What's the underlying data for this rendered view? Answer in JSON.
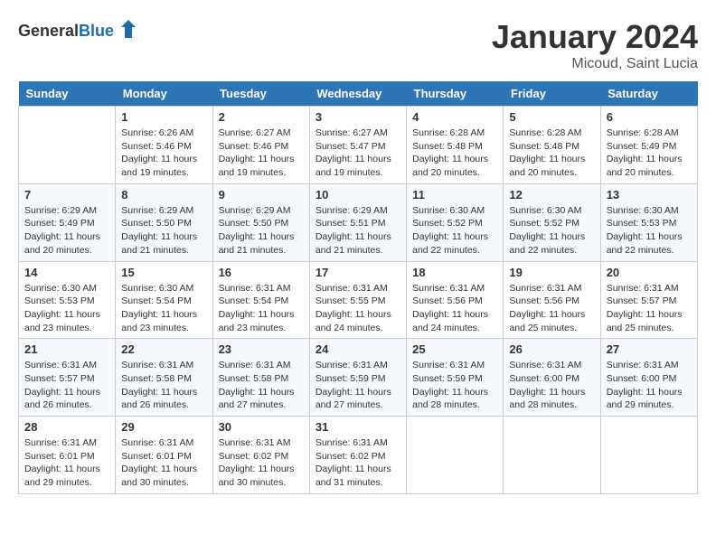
{
  "header": {
    "logo_general": "General",
    "logo_blue": "Blue",
    "month_title": "January 2024",
    "location": "Micoud, Saint Lucia"
  },
  "days_of_week": [
    "Sunday",
    "Monday",
    "Tuesday",
    "Wednesday",
    "Thursday",
    "Friday",
    "Saturday"
  ],
  "weeks": [
    [
      {
        "day": "",
        "info": ""
      },
      {
        "day": "1",
        "info": "Sunrise: 6:26 AM\nSunset: 5:46 PM\nDaylight: 11 hours\nand 19 minutes."
      },
      {
        "day": "2",
        "info": "Sunrise: 6:27 AM\nSunset: 5:46 PM\nDaylight: 11 hours\nand 19 minutes."
      },
      {
        "day": "3",
        "info": "Sunrise: 6:27 AM\nSunset: 5:47 PM\nDaylight: 11 hours\nand 19 minutes."
      },
      {
        "day": "4",
        "info": "Sunrise: 6:28 AM\nSunset: 5:48 PM\nDaylight: 11 hours\nand 20 minutes."
      },
      {
        "day": "5",
        "info": "Sunrise: 6:28 AM\nSunset: 5:48 PM\nDaylight: 11 hours\nand 20 minutes."
      },
      {
        "day": "6",
        "info": "Sunrise: 6:28 AM\nSunset: 5:49 PM\nDaylight: 11 hours\nand 20 minutes."
      }
    ],
    [
      {
        "day": "7",
        "info": "Sunrise: 6:29 AM\nSunset: 5:49 PM\nDaylight: 11 hours\nand 20 minutes."
      },
      {
        "day": "8",
        "info": "Sunrise: 6:29 AM\nSunset: 5:50 PM\nDaylight: 11 hours\nand 21 minutes."
      },
      {
        "day": "9",
        "info": "Sunrise: 6:29 AM\nSunset: 5:50 PM\nDaylight: 11 hours\nand 21 minutes."
      },
      {
        "day": "10",
        "info": "Sunrise: 6:29 AM\nSunset: 5:51 PM\nDaylight: 11 hours\nand 21 minutes."
      },
      {
        "day": "11",
        "info": "Sunrise: 6:30 AM\nSunset: 5:52 PM\nDaylight: 11 hours\nand 22 minutes."
      },
      {
        "day": "12",
        "info": "Sunrise: 6:30 AM\nSunset: 5:52 PM\nDaylight: 11 hours\nand 22 minutes."
      },
      {
        "day": "13",
        "info": "Sunrise: 6:30 AM\nSunset: 5:53 PM\nDaylight: 11 hours\nand 22 minutes."
      }
    ],
    [
      {
        "day": "14",
        "info": "Sunrise: 6:30 AM\nSunset: 5:53 PM\nDaylight: 11 hours\nand 23 minutes."
      },
      {
        "day": "15",
        "info": "Sunrise: 6:30 AM\nSunset: 5:54 PM\nDaylight: 11 hours\nand 23 minutes."
      },
      {
        "day": "16",
        "info": "Sunrise: 6:31 AM\nSunset: 5:54 PM\nDaylight: 11 hours\nand 23 minutes."
      },
      {
        "day": "17",
        "info": "Sunrise: 6:31 AM\nSunset: 5:55 PM\nDaylight: 11 hours\nand 24 minutes."
      },
      {
        "day": "18",
        "info": "Sunrise: 6:31 AM\nSunset: 5:56 PM\nDaylight: 11 hours\nand 24 minutes."
      },
      {
        "day": "19",
        "info": "Sunrise: 6:31 AM\nSunset: 5:56 PM\nDaylight: 11 hours\nand 25 minutes."
      },
      {
        "day": "20",
        "info": "Sunrise: 6:31 AM\nSunset: 5:57 PM\nDaylight: 11 hours\nand 25 minutes."
      }
    ],
    [
      {
        "day": "21",
        "info": "Sunrise: 6:31 AM\nSunset: 5:57 PM\nDaylight: 11 hours\nand 26 minutes."
      },
      {
        "day": "22",
        "info": "Sunrise: 6:31 AM\nSunset: 5:58 PM\nDaylight: 11 hours\nand 26 minutes."
      },
      {
        "day": "23",
        "info": "Sunrise: 6:31 AM\nSunset: 5:58 PM\nDaylight: 11 hours\nand 27 minutes."
      },
      {
        "day": "24",
        "info": "Sunrise: 6:31 AM\nSunset: 5:59 PM\nDaylight: 11 hours\nand 27 minutes."
      },
      {
        "day": "25",
        "info": "Sunrise: 6:31 AM\nSunset: 5:59 PM\nDaylight: 11 hours\nand 28 minutes."
      },
      {
        "day": "26",
        "info": "Sunrise: 6:31 AM\nSunset: 6:00 PM\nDaylight: 11 hours\nand 28 minutes."
      },
      {
        "day": "27",
        "info": "Sunrise: 6:31 AM\nSunset: 6:00 PM\nDaylight: 11 hours\nand 29 minutes."
      }
    ],
    [
      {
        "day": "28",
        "info": "Sunrise: 6:31 AM\nSunset: 6:01 PM\nDaylight: 11 hours\nand 29 minutes."
      },
      {
        "day": "29",
        "info": "Sunrise: 6:31 AM\nSunset: 6:01 PM\nDaylight: 11 hours\nand 30 minutes."
      },
      {
        "day": "30",
        "info": "Sunrise: 6:31 AM\nSunset: 6:02 PM\nDaylight: 11 hours\nand 30 minutes."
      },
      {
        "day": "31",
        "info": "Sunrise: 6:31 AM\nSunset: 6:02 PM\nDaylight: 11 hours\nand 31 minutes."
      },
      {
        "day": "",
        "info": ""
      },
      {
        "day": "",
        "info": ""
      },
      {
        "day": "",
        "info": ""
      }
    ]
  ]
}
